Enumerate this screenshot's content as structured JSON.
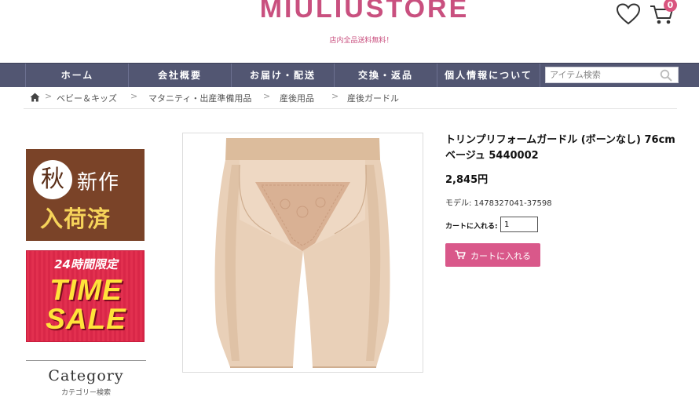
{
  "header": {
    "logo": "MIULIUSTORE",
    "tagline": "店内全品送料無料！",
    "cart_count": "0"
  },
  "nav": {
    "items": [
      "ホーム",
      "会社概要",
      "お届け・配送",
      "交換・返品",
      "個人情報について"
    ],
    "search_placeholder": "アイテム検索"
  },
  "breadcrumb": [
    "ベビー＆キッズ",
    "マタニティ・出産準備用品",
    "産後用品",
    "産後ガードル"
  ],
  "sidebar": {
    "autumn_banner": {
      "circle": "秋",
      "line1": "新作",
      "line2": "入荷済"
    },
    "sale_banner": {
      "top": "24時間限定",
      "line1": "TIME",
      "line2": "SALE"
    },
    "category_title": "Category",
    "category_sub": "カテゴリー検索"
  },
  "product": {
    "title": "トリンプリフォームガードル (ボーンなし) 76cm ベージュ 5440002",
    "price": "2,845円",
    "model": "モデル: 1478327041-37598",
    "qty_label": "カートに入れる:",
    "qty_value": "1",
    "add_to_cart": "カートに入れる"
  },
  "colors": {
    "brand_pink": "#c9507f",
    "nav_bg": "#525672",
    "button_pink": "#d9588a"
  }
}
